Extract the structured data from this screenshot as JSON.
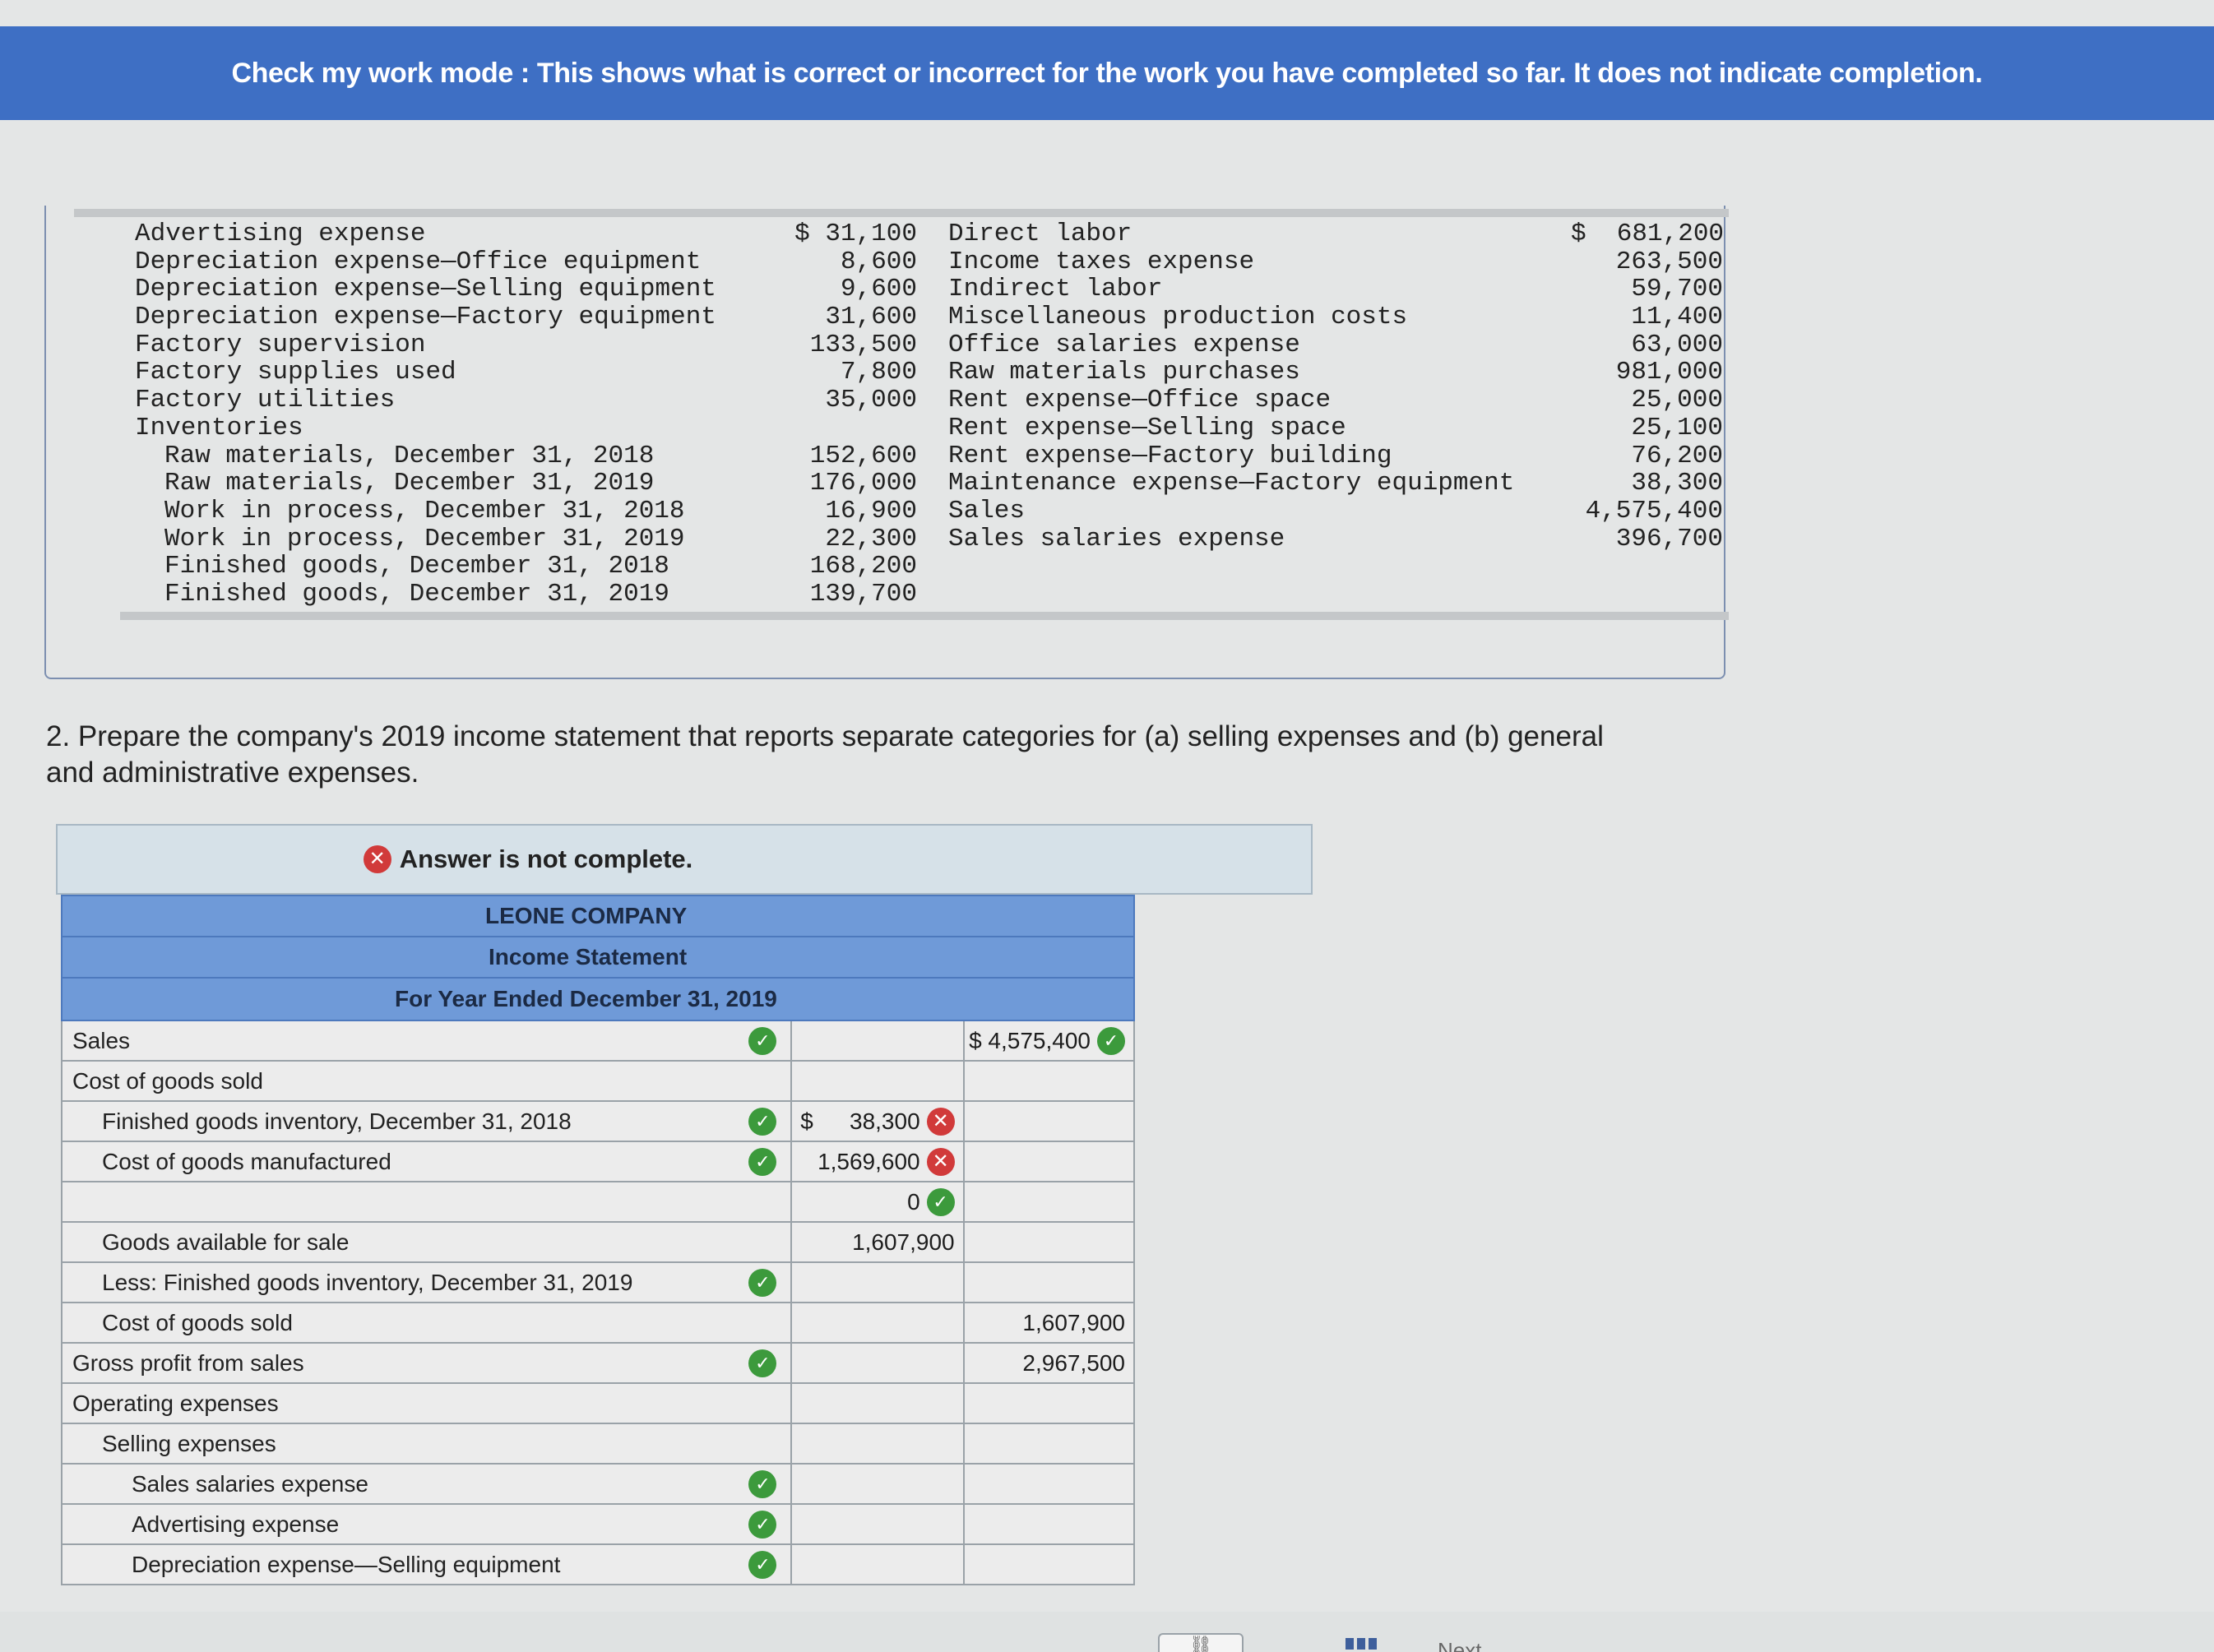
{
  "banner": {
    "text": "Check my work mode : This shows what is correct or incorrect for the work you have completed so far. It does not indicate completion."
  },
  "data_list": {
    "left": [
      {
        "label": "Advertising expense",
        "value": "$ 31,100",
        "indent": 0
      },
      {
        "label": "Depreciation expense—Office equipment",
        "value": "8,600",
        "indent": 0
      },
      {
        "label": "Depreciation expense—Selling equipment",
        "value": "9,600",
        "indent": 0
      },
      {
        "label": "Depreciation expense—Factory equipment",
        "value": "31,600",
        "indent": 0
      },
      {
        "label": "Factory supervision",
        "value": "133,500",
        "indent": 0
      },
      {
        "label": "Factory supplies used",
        "value": "7,800",
        "indent": 0
      },
      {
        "label": "Factory utilities",
        "value": "35,000",
        "indent": 0
      },
      {
        "label": "Inventories",
        "value": "",
        "indent": 0
      },
      {
        "label": "Raw materials, December 31, 2018",
        "value": "152,600",
        "indent": 1
      },
      {
        "label": "Raw materials, December 31, 2019",
        "value": "176,000",
        "indent": 1
      },
      {
        "label": "Work in process, December 31, 2018",
        "value": "16,900",
        "indent": 1
      },
      {
        "label": "Work in process, December 31, 2019",
        "value": "22,300",
        "indent": 1
      },
      {
        "label": "Finished goods, December 31, 2018",
        "value": "168,200",
        "indent": 1
      },
      {
        "label": "Finished goods, December 31, 2019",
        "value": "139,700",
        "indent": 1
      }
    ],
    "right": [
      {
        "label": "Direct labor",
        "value": "$  681,200"
      },
      {
        "label": "Income taxes expense",
        "value": "263,500"
      },
      {
        "label": "Indirect labor",
        "value": "59,700"
      },
      {
        "label": "Miscellaneous production costs",
        "value": "11,400"
      },
      {
        "label": "Office salaries expense",
        "value": "63,000"
      },
      {
        "label": "Raw materials purchases",
        "value": "981,000"
      },
      {
        "label": "Rent expense—Office space",
        "value": "25,000"
      },
      {
        "label": "Rent expense—Selling space",
        "value": "25,100"
      },
      {
        "label": "Rent expense—Factory building",
        "value": "76,200"
      },
      {
        "label": "Maintenance expense—Factory equipment",
        "value": "38,300"
      },
      {
        "label": "Sales",
        "value": "4,575,400"
      },
      {
        "label": "Sales salaries expense",
        "value": "396,700"
      }
    ]
  },
  "question": {
    "text": "2. Prepare the company's 2019 income statement that reports separate categories for (a) selling expenses and (b) general and administrative expenses."
  },
  "status": {
    "text": "Answer is not complete."
  },
  "statement": {
    "company": "LEONE COMPANY",
    "title": "Income Statement",
    "period": "For Year Ended December 31, 2019",
    "rows": [
      {
        "label": "Sales",
        "level": 0,
        "mark": "check",
        "c1": "",
        "c1_dollar": false,
        "c1_mark": "",
        "c2": "$ 4,575,400",
        "c2_mark": "check"
      },
      {
        "label": "Cost of goods sold",
        "level": 0,
        "mark": "",
        "c1": "",
        "c1_dollar": false,
        "c1_mark": "",
        "c2": "",
        "c2_mark": ""
      },
      {
        "label": "Finished goods inventory, December 31, 2018",
        "level": 1,
        "mark": "check",
        "c1": "38,300",
        "c1_dollar": true,
        "c1_mark": "x",
        "c2": "",
        "c2_mark": ""
      },
      {
        "label": "Cost of goods manufactured",
        "level": 1,
        "mark": "check",
        "c1": "1,569,600",
        "c1_dollar": false,
        "c1_mark": "x",
        "c2": "",
        "c2_mark": ""
      },
      {
        "label": "",
        "level": 1,
        "mark": "",
        "c1": "0",
        "c1_dollar": false,
        "c1_mark": "check",
        "c2": "",
        "c2_mark": ""
      },
      {
        "label": "Goods available for sale",
        "level": 1,
        "mark": "",
        "c1": "1,607,900",
        "c1_dollar": false,
        "c1_mark": "",
        "c2": "",
        "c2_mark": ""
      },
      {
        "label": "Less: Finished goods inventory, December 31, 2019",
        "level": 1,
        "mark": "check",
        "c1": "",
        "c1_dollar": false,
        "c1_mark": "",
        "c2": "",
        "c2_mark": ""
      },
      {
        "label": "Cost of goods sold",
        "level": 1,
        "mark": "",
        "c1": "",
        "c1_dollar": false,
        "c1_mark": "",
        "c2": "1,607,900",
        "c2_mark": ""
      },
      {
        "label": "Gross profit from sales",
        "level": 0,
        "mark": "check",
        "c1": "",
        "c1_dollar": false,
        "c1_mark": "",
        "c2": "2,967,500",
        "c2_mark": ""
      },
      {
        "label": "Operating expenses",
        "level": 0,
        "mark": "",
        "c1": "",
        "c1_dollar": false,
        "c1_mark": "",
        "c2": "",
        "c2_mark": ""
      },
      {
        "label": "Selling expenses",
        "level": 1,
        "mark": "",
        "c1": "",
        "c1_dollar": false,
        "c1_mark": "",
        "c2": "",
        "c2_mark": ""
      },
      {
        "label": "Sales salaries expense",
        "level": 2,
        "mark": "check",
        "c1": "",
        "c1_dollar": false,
        "c1_mark": "",
        "c2": "",
        "c2_mark": ""
      },
      {
        "label": "Advertising expense",
        "level": 2,
        "mark": "check",
        "c1": "",
        "c1_dollar": false,
        "c1_mark": "",
        "c2": "",
        "c2_mark": ""
      },
      {
        "label": "Depreciation expense—Selling equipment",
        "level": 2,
        "mark": "check",
        "c1": "",
        "c1_dollar": false,
        "c1_mark": "",
        "c2": "",
        "c2_mark": ""
      }
    ]
  },
  "footer": {
    "next_label": "Next"
  },
  "colors": {
    "banner": "#3e6fc4",
    "header": "#6f9ad8",
    "check": "#3c9a3c",
    "cross": "#d13a3a"
  }
}
